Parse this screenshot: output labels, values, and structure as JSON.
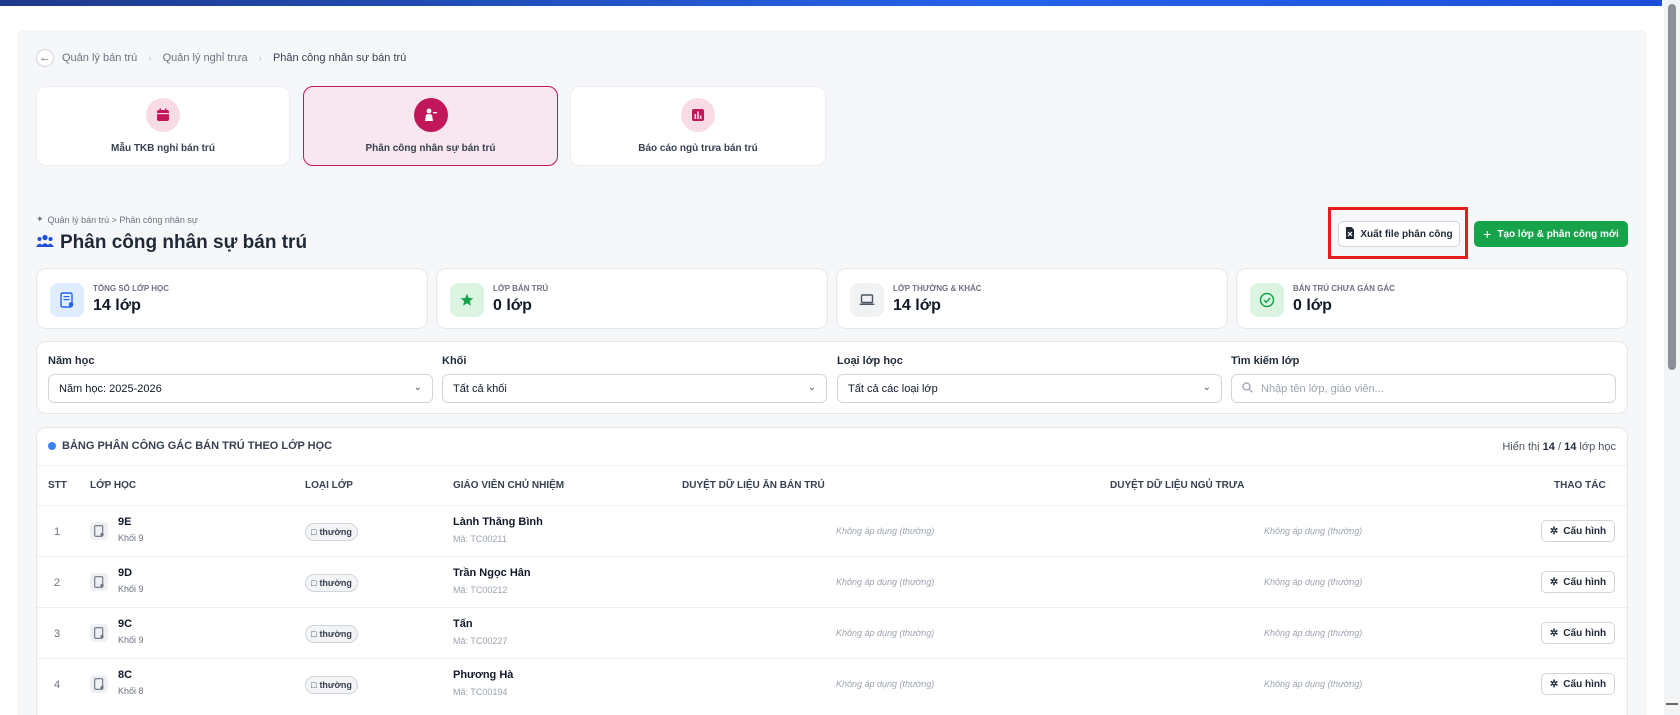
{
  "breadcrumb": {
    "items": [
      "Quản lý bán trú",
      "Quản lý nghỉ trưa",
      "Phân công nhân sự bán trú"
    ]
  },
  "nav_cards": [
    {
      "label": "Mẫu TKB nghỉ bán trú",
      "icon": "calendar-icon",
      "active": false
    },
    {
      "label": "Phân công nhân sự bán trú",
      "icon": "teacher-icon",
      "active": true
    },
    {
      "label": "Báo cáo ngủ trưa bán trú",
      "icon": "chart-icon",
      "active": false
    }
  ],
  "sub_breadcrumb": "Quản lý bán trú > Phân công nhân sự",
  "page_title": "Phân công nhân sự bán trú",
  "actions": {
    "export_label": "Xuất file phân công",
    "create_label": "Tạo lớp & phân công mới"
  },
  "stats": [
    {
      "label": "Tổng số lớp học",
      "value": "14 lớp",
      "icon": "classroom-icon",
      "color": "#e0ecff"
    },
    {
      "label": "Lớp bán trú",
      "value": "0 lớp",
      "icon": "star-icon",
      "color": "#dcf5e3"
    },
    {
      "label": "Lớp thường & khác",
      "value": "14 lớp",
      "icon": "laptop-icon",
      "color": "#f1f2f4"
    },
    {
      "label": "Bán trú chưa gán gác",
      "value": "0 lớp",
      "icon": "check-circle-icon",
      "color": "#dcf5e3"
    }
  ],
  "filters": {
    "year": {
      "label": "Năm học",
      "value": "Năm học: 2025-2026"
    },
    "grade": {
      "label": "Khối",
      "value": "Tất cả khối"
    },
    "class_type": {
      "label": "Loại lớp học",
      "value": "Tất cả các loại lớp"
    },
    "search": {
      "label": "Tìm kiếm lớp",
      "placeholder": "Nhập tên lớp, giáo viên..."
    }
  },
  "table": {
    "title": "BẢNG PHÂN CÔNG GÁC BÁN TRÚ THEO LỚP HỌC",
    "count_prefix": "Hiển thị",
    "shown": "14",
    "sep": "/",
    "total": "14",
    "count_suffix": "lớp học",
    "headers": {
      "stt": "STT",
      "class": "LỚP HỌC",
      "type": "LOẠI LỚP",
      "teacher": "GIÁO VIÊN CHỦ NHIỆM",
      "meal": "DUYỆT DỮ LIỆU ĂN BÁN TRÚ",
      "nap": "DUYỆT DỮ LIỆU NGỦ TRƯA",
      "action": "THAO TÁC"
    },
    "rows": [
      {
        "stt": "1",
        "class": "9E",
        "grade": "Khối 9",
        "type": "thường",
        "teacher": "Lành Thăng Bình",
        "code": "Mã: TC00211",
        "meal": "Không áp dụng (thường)",
        "nap": "Không áp dụng (thường)",
        "action": "Cấu hình"
      },
      {
        "stt": "2",
        "class": "9D",
        "grade": "Khối 9",
        "type": "thường",
        "teacher": "Trần Ngọc Hân",
        "code": "Mã: TC00212",
        "meal": "Không áp dụng (thường)",
        "nap": "Không áp dụng (thường)",
        "action": "Cấu hình"
      },
      {
        "stt": "3",
        "class": "9C",
        "grade": "Khối 9",
        "type": "thường",
        "teacher": "Tấn",
        "code": "Mã: TC00227",
        "meal": "Không áp dụng (thường)",
        "nap": "Không áp dụng (thường)",
        "action": "Cấu hình"
      },
      {
        "stt": "4",
        "class": "8C",
        "grade": "Khối 8",
        "type": "thường",
        "teacher": "Phương Hà",
        "code": "Mã: TC00194",
        "meal": "Không áp dụng (thường)",
        "nap": "Không áp dụng (thường)",
        "action": "Cấu hình"
      }
    ]
  },
  "colors": {
    "accent_pink": "#c2185b",
    "accent_green": "#16a34a",
    "highlight_red": "#e11d1d",
    "accent_blue": "#3b82f6"
  }
}
